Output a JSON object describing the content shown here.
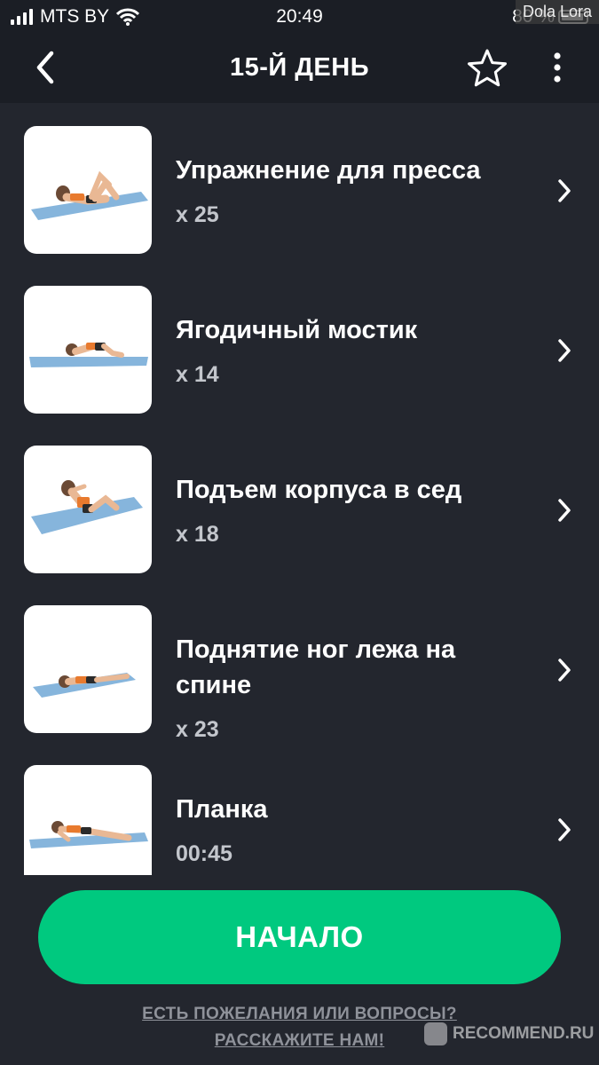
{
  "status_bar": {
    "carrier": "MTS BY",
    "time": "20:49",
    "battery": "80 %"
  },
  "watermark_top": "Dola Lora",
  "header": {
    "title": "15-Й ДЕНЬ",
    "back_icon": "chevron-left-icon",
    "favorite_icon": "star-outline-icon",
    "more_icon": "vertical-dots-icon"
  },
  "exercises": [
    {
      "name": "Упражнение для пресса",
      "reps": "x 25"
    },
    {
      "name": "Ягодичный мостик",
      "reps": "x 14"
    },
    {
      "name": "Подъем корпуса в сед",
      "reps": "x 18"
    },
    {
      "name": "Поднятие ног лежа на спине",
      "reps": "x 23"
    },
    {
      "name": "Планка",
      "reps": "00:45"
    }
  ],
  "start_button": "НАЧАЛО",
  "feedback": {
    "line1": "ЕСТЬ ПОЖЕЛАНИЯ ИЛИ ВОПРОСЫ?",
    "line2": "РАССКАЖИТЕ НАМ!"
  },
  "watermark_bottom": "RECOMMEND.RU",
  "colors": {
    "background": "#23262e",
    "header": "#1b1e25",
    "accent_green": "#00c97f",
    "mat_blue": "#86b5dc"
  }
}
